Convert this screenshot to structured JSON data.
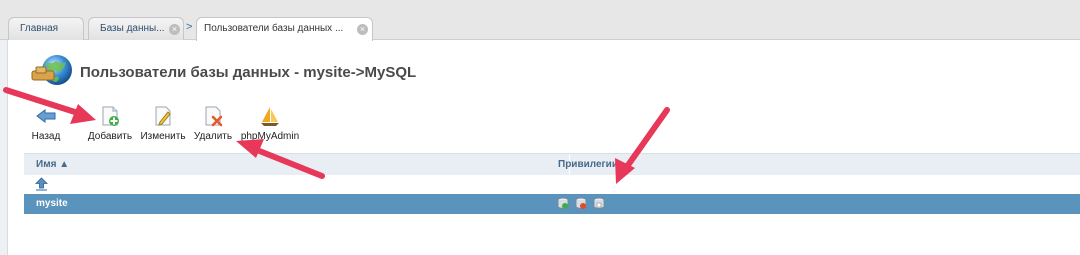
{
  "tabs": [
    {
      "label": "Главная"
    },
    {
      "label": "Базы данны..."
    },
    {
      "label": "Пользователи базы данных ..."
    }
  ],
  "header": {
    "title": "Пользователи базы данных - mysite->MySQL"
  },
  "toolbar": {
    "back_label": "Назад",
    "add_label": "Добавить",
    "edit_label": "Изменить",
    "delete_label": "Удалить",
    "phpmyadmin_label": "phpMyAdmin"
  },
  "table": {
    "columns": [
      {
        "label": "Имя ▲"
      },
      {
        "label": "Привилегии"
      }
    ],
    "rows": [
      {
        "name": "mysite"
      }
    ]
  },
  "colors": {
    "selected_row": "#5a93bb",
    "annotation_arrow": "#e8385a"
  }
}
